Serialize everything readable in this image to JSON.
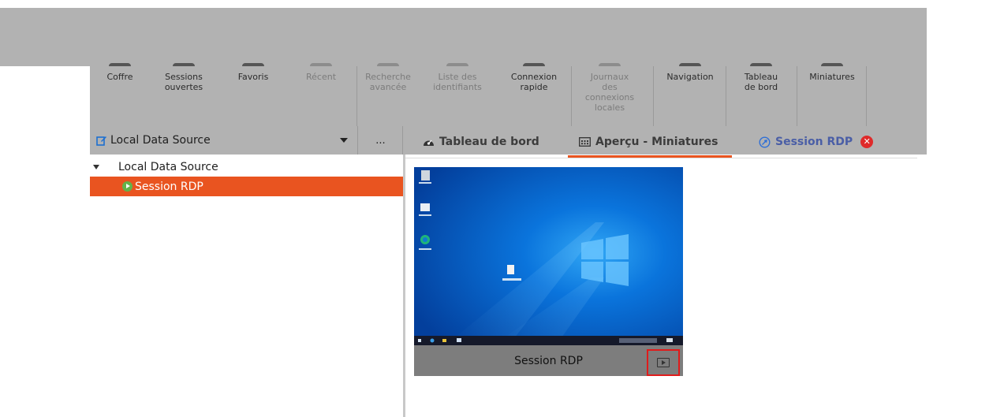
{
  "ribbon": {
    "buttons": [
      {
        "label": "Coffre",
        "enabled": true
      },
      {
        "label": "Sessions\nouvertes",
        "enabled": true
      },
      {
        "label": "Favoris",
        "enabled": true
      },
      {
        "label": "Récent",
        "enabled": false
      },
      {
        "label": "Recherche\navancée",
        "enabled": false
      },
      {
        "label": "Liste des\nidentifiants",
        "enabled": false
      },
      {
        "label": "Connexion\nrapide",
        "enabled": true
      },
      {
        "label": "Journaux\ndes\nconnexions\nlocales",
        "enabled": false
      },
      {
        "label": "Navigation",
        "enabled": true
      },
      {
        "label": "Tableau\nde bord",
        "enabled": true
      },
      {
        "label": "Miniatures",
        "enabled": true
      }
    ]
  },
  "datasource": {
    "selected": "Local Data Source",
    "more_label": "..."
  },
  "tabs": [
    {
      "label": "Tableau de bord",
      "icon": "dashboard-icon"
    },
    {
      "label": "Aperçu - Miniatures",
      "icon": "thumbnails-icon",
      "active": true
    },
    {
      "label": "Session RDP",
      "icon": "rdp-icon",
      "closable": true
    }
  ],
  "tree": {
    "root": "Local Data Source",
    "items": [
      {
        "label": "Session RDP",
        "selected": true
      }
    ]
  },
  "thumbnail": {
    "caption": "Session RDP"
  },
  "colors": {
    "accent": "#e95420",
    "overlay": "#b2b2b2",
    "close": "#df2a2a",
    "highlight_border": "#e01b1b"
  }
}
